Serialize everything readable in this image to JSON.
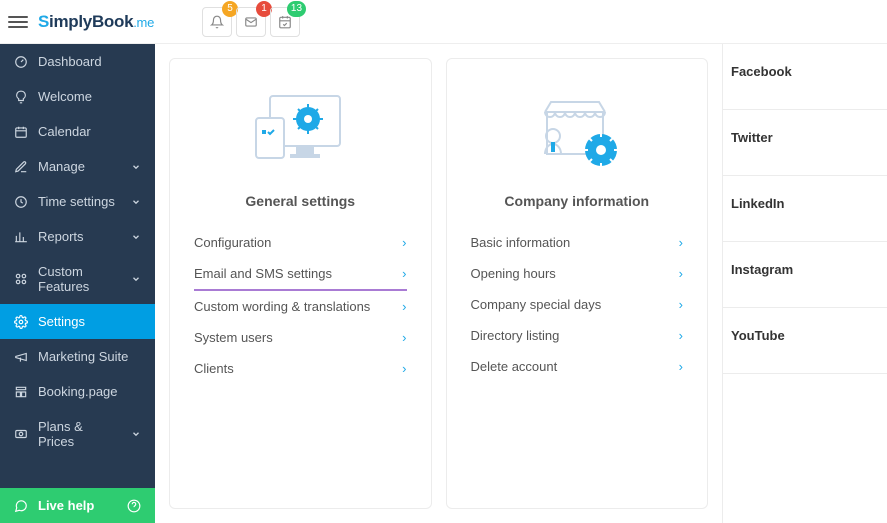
{
  "brand": {
    "prefix": "S",
    "middle": "implyBook",
    "suffix": ".me"
  },
  "topIcons": {
    "notif_badge": "5",
    "mail_badge": "1",
    "check_badge": "13"
  },
  "sidebar": {
    "items": [
      {
        "label": "Dashboard",
        "chev": false
      },
      {
        "label": "Welcome",
        "chev": false
      },
      {
        "label": "Calendar",
        "chev": false
      },
      {
        "label": "Manage",
        "chev": true
      },
      {
        "label": "Time settings",
        "chev": true
      },
      {
        "label": "Reports",
        "chev": true
      },
      {
        "label": "Custom Features",
        "chev": true
      },
      {
        "label": "Settings",
        "chev": false
      },
      {
        "label": "Marketing Suite",
        "chev": false
      },
      {
        "label": "Booking.page",
        "chev": false
      },
      {
        "label": "Plans & Prices",
        "chev": true
      }
    ],
    "help": "Live help"
  },
  "cards": {
    "general": {
      "title": "General settings",
      "links": [
        "Configuration",
        "Email and SMS settings",
        "Custom wording & translations",
        "System users",
        "Clients"
      ]
    },
    "company": {
      "title": "Company information",
      "links": [
        "Basic information",
        "Opening hours",
        "Company special days",
        "Directory listing",
        "Delete account"
      ]
    }
  },
  "social": [
    "Facebook",
    "Twitter",
    "LinkedIn",
    "Instagram",
    "YouTube"
  ]
}
